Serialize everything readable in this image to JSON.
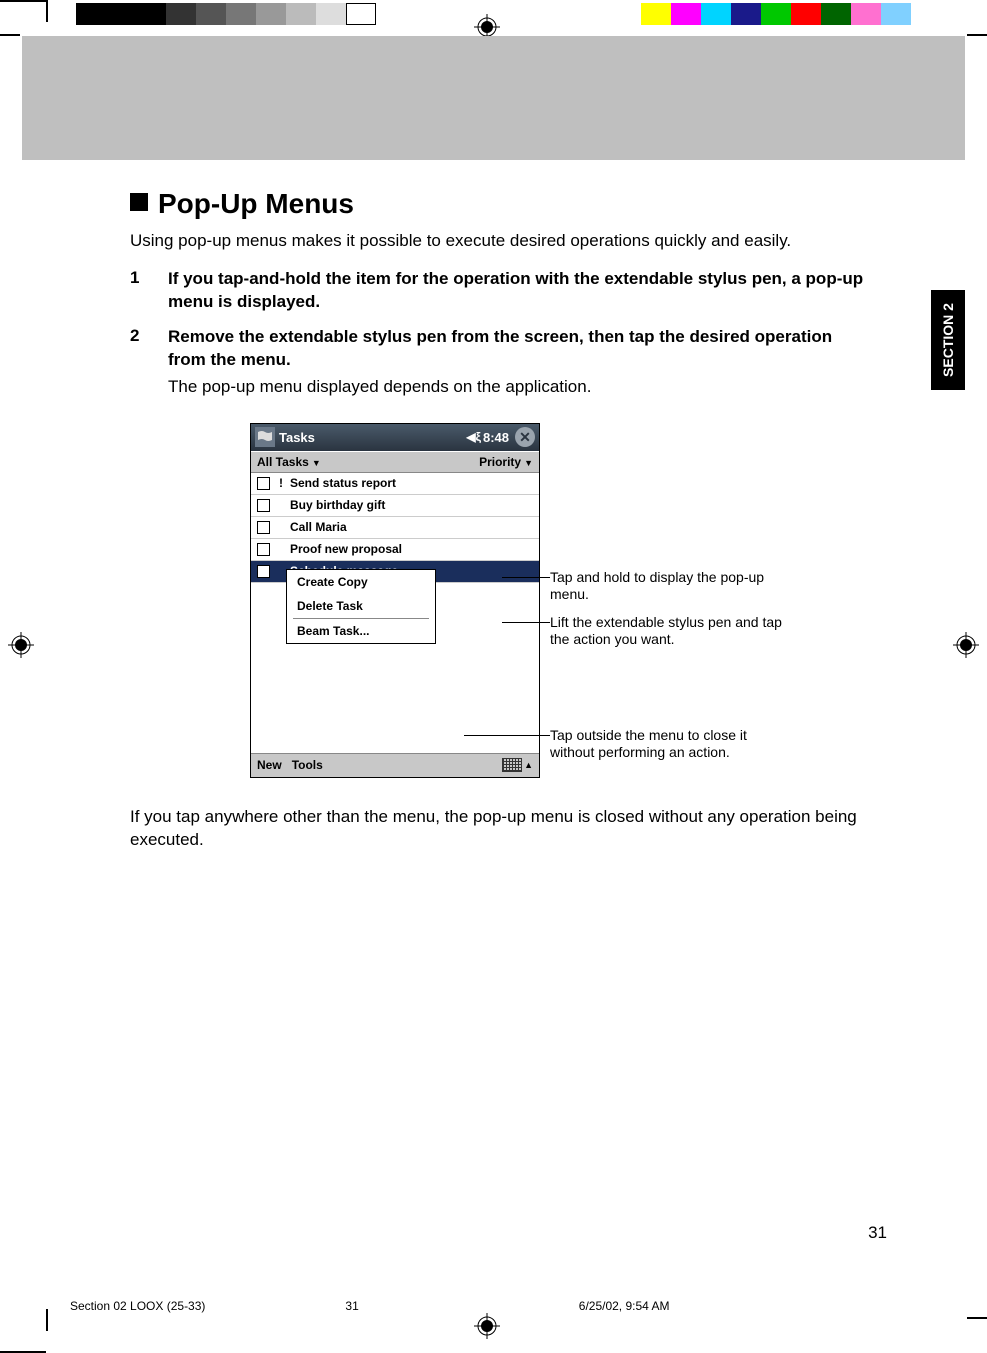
{
  "heading": "Pop-Up Menus",
  "intro": "Using pop-up menus makes it possible to execute desired operations quickly and easily.",
  "steps": [
    {
      "num": "1",
      "bold": "If you tap-and-hold the item for the operation with the extendable stylus pen, a pop-up menu is displayed."
    },
    {
      "num": "2",
      "bold": "Remove the extendable stylus pen from the screen, then tap the desired operation from the menu.",
      "plain": "The pop-up menu displayed depends on the application."
    }
  ],
  "screenshot": {
    "title": "Tasks",
    "time": "8:48",
    "filter_left": "All Tasks",
    "filter_right": "Priority",
    "tasks": [
      {
        "priority": "!",
        "label": "Send status report"
      },
      {
        "priority": "",
        "label": "Buy birthday gift"
      },
      {
        "priority": "",
        "label": "Call Maria"
      },
      {
        "priority": "",
        "label": "Proof new proposal"
      },
      {
        "priority": "",
        "label": "Schedule massage",
        "selected": true
      }
    ],
    "popup": [
      "Create Copy",
      "Delete Task",
      "Beam Task..."
    ],
    "bottom_new": "New",
    "bottom_tools": "Tools"
  },
  "callouts": {
    "c1": "Tap and hold to display the pop-up menu.",
    "c2": "Lift the extendable stylus pen and tap the action you want.",
    "c3": "Tap outside the menu to close it without performing an action."
  },
  "closing": "If you tap anywhere other than the menu, the pop-up menu is closed without any operation being executed.",
  "section_tab": "SECTION 2",
  "page_number": "31",
  "footer": {
    "left": "Section 02 LOOX (25-33)",
    "mid": "31",
    "right": "6/25/02, 9:54 AM"
  }
}
